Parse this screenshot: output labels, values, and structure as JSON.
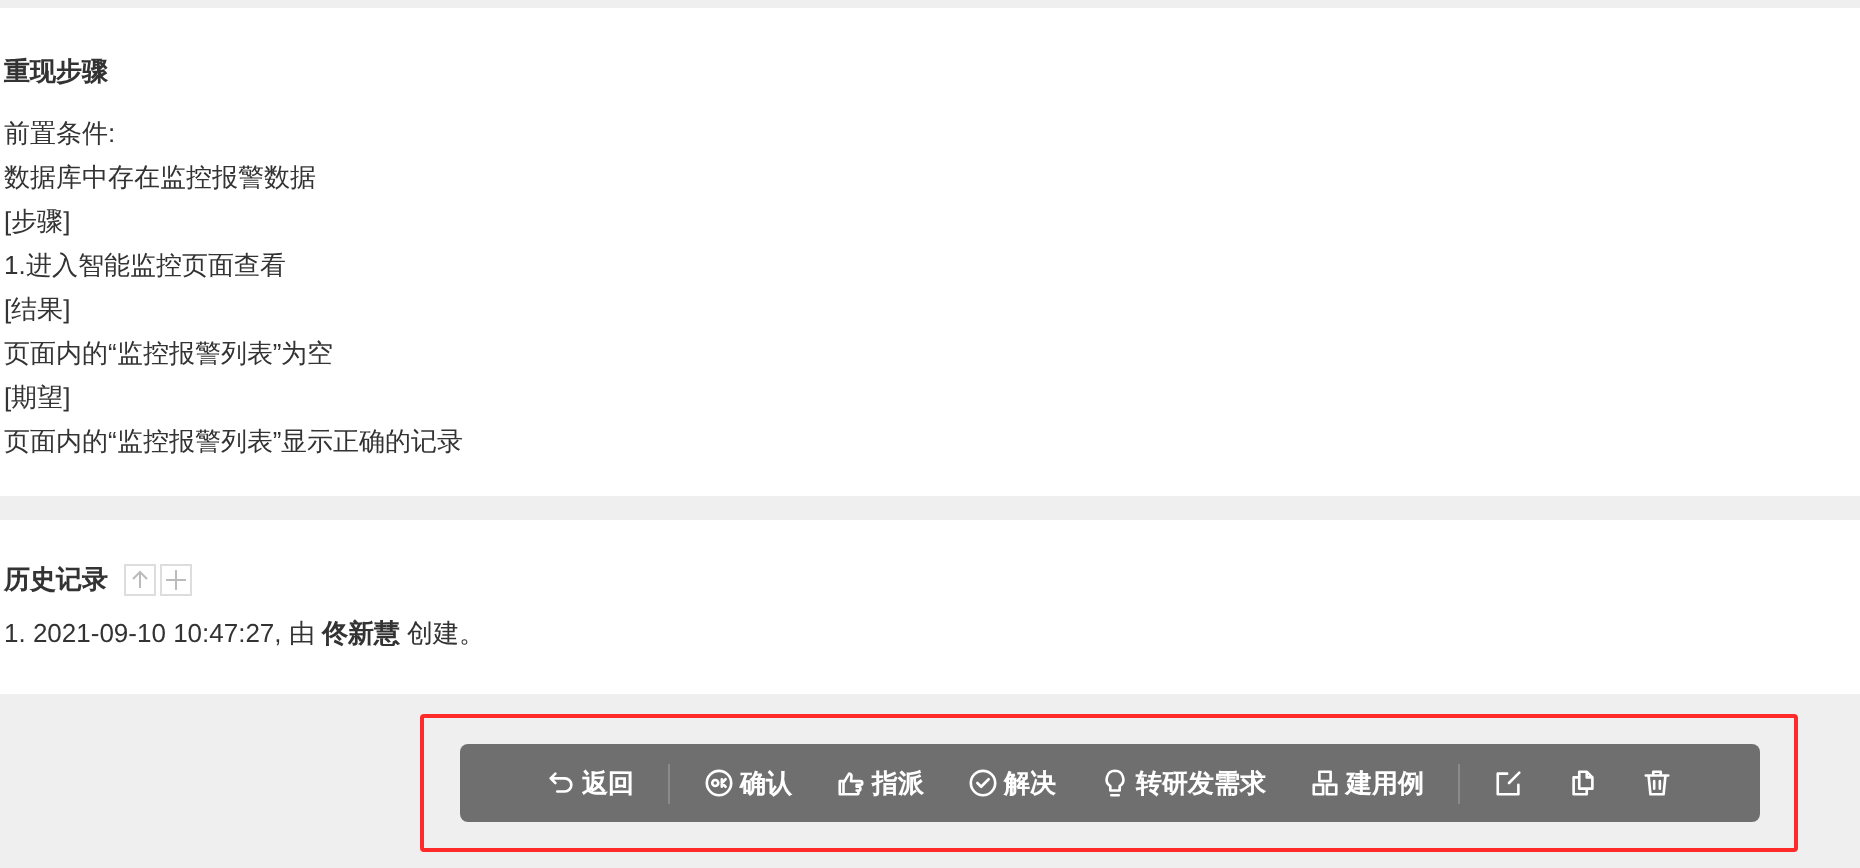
{
  "steps": {
    "title": "重现步骤",
    "lines": [
      "前置条件:",
      "数据库中存在监控报警数据",
      "[步骤]",
      "1.进入智能监控页面查看",
      "[结果]",
      "页面内的“监控报警列表”为空",
      "[期望]",
      "页面内的“监控报警列表”显示正确的记录"
    ]
  },
  "history": {
    "title": "历史记录",
    "entries": [
      "1. 2021-09-10 10:47:27, 由 **佟新慧** 创建。"
    ]
  },
  "toolbar": {
    "highlighted": true,
    "groups": [
      [
        {
          "kind": "back",
          "label": "返回"
        }
      ],
      [
        {
          "kind": "confirm",
          "label": "确认"
        },
        {
          "kind": "assign",
          "label": "指派"
        },
        {
          "kind": "resolve",
          "label": "解决"
        },
        {
          "kind": "story",
          "label": "转研发需求"
        },
        {
          "kind": "case",
          "label": "建用例"
        }
      ],
      [
        {
          "kind": "edit"
        },
        {
          "kind": "copy"
        },
        {
          "kind": "delete"
        }
      ]
    ]
  }
}
